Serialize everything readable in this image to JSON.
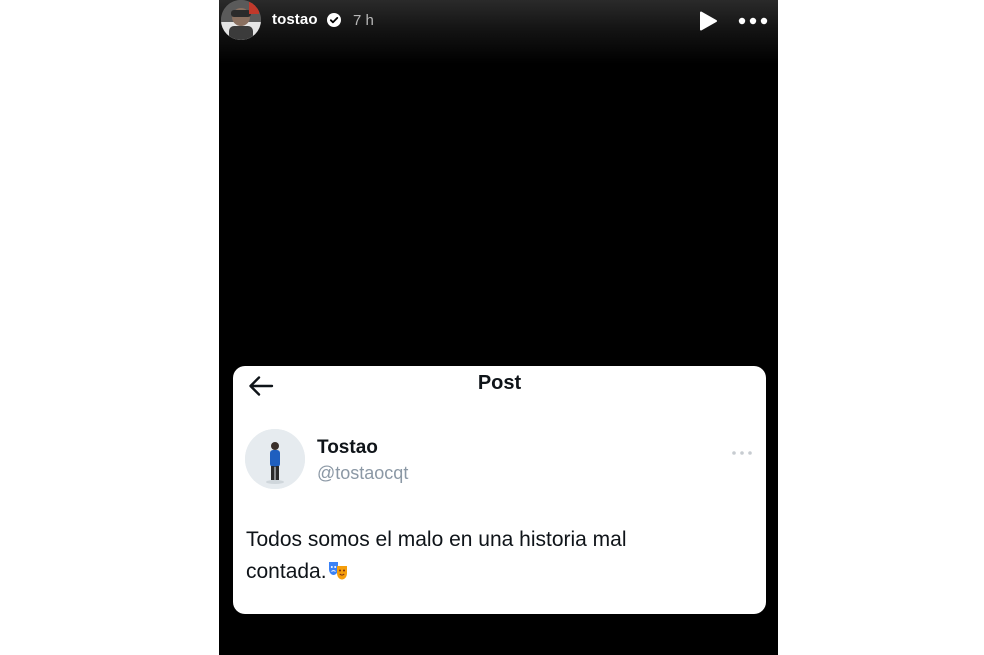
{
  "story": {
    "username": "tostao",
    "timestamp": "7 h",
    "icons": {
      "verified": "verified-badge-icon",
      "play": "play-icon",
      "more": "more-horizontal-icon"
    }
  },
  "post": {
    "header_title": "Post",
    "display_name": "Tostao",
    "handle": "@tostaocqt",
    "text_line1": "Todos somos el malo en una historia mal",
    "text_line2": "contada.",
    "emoji": "performing-arts-masks-icon",
    "icons": {
      "back": "back-arrow-icon",
      "more": "more-horizontal-icon"
    }
  },
  "colors": {
    "story_background": "#000000",
    "page_background": "#ffffff",
    "card_background": "#ffffff",
    "primary_text": "#0f1419",
    "secondary_text": "#8b98a5"
  }
}
